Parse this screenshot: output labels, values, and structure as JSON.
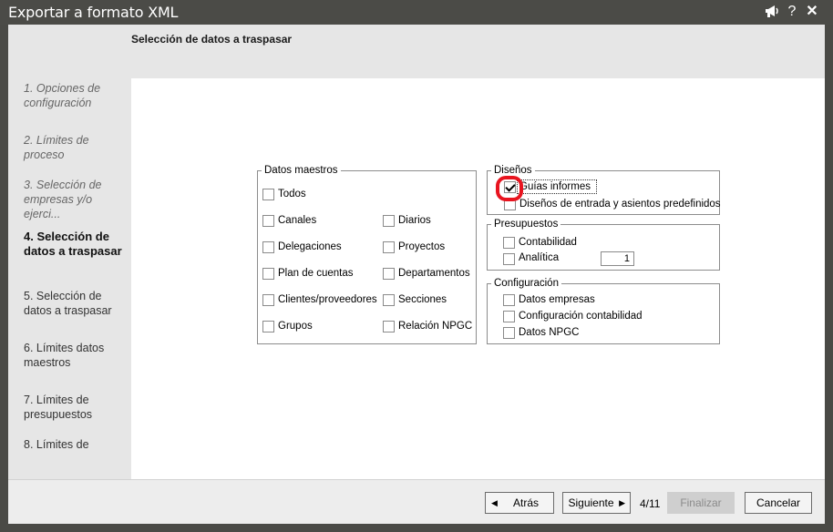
{
  "window": {
    "title": "Exportar a formato XML",
    "icons": [
      "megaphone-icon",
      "help-icon",
      "close-icon"
    ],
    "help_glyph": "?",
    "close_glyph": "✕"
  },
  "header": {
    "title": "Selección de datos a traspasar"
  },
  "sidebar": {
    "steps": [
      {
        "label": "1. Opciones de configuración",
        "state": "done"
      },
      {
        "label": "2. Límites de proceso",
        "state": "done"
      },
      {
        "label": "3. Selección de empresas y/o ejerci...",
        "state": "done"
      },
      {
        "label": "4. Selección de datos a traspasar",
        "state": "current"
      },
      {
        "label": "5. Selección de datos a traspasar",
        "state": "pending"
      },
      {
        "label": "6. Límites datos maestros",
        "state": "pending"
      },
      {
        "label": "7. Límites de presupuestos",
        "state": "pending"
      },
      {
        "label": "8. Límites de",
        "state": "pending"
      }
    ]
  },
  "datos_maestros": {
    "title": "Datos maestros",
    "left": [
      {
        "label": "Todos",
        "checked": false
      },
      {
        "label": "Canales",
        "checked": false
      },
      {
        "label": "Delegaciones",
        "checked": false
      },
      {
        "label": "Plan de cuentas",
        "checked": false
      },
      {
        "label": "Clientes/proveedores",
        "checked": false
      },
      {
        "label": "Grupos",
        "checked": false
      }
    ],
    "right": [
      {
        "label": "Diarios",
        "checked": false
      },
      {
        "label": "Proyectos",
        "checked": false
      },
      {
        "label": "Departamentos",
        "checked": false
      },
      {
        "label": "Secciones",
        "checked": false
      },
      {
        "label": "Relación NPGC",
        "checked": false
      }
    ]
  },
  "disenos": {
    "title": "Diseños",
    "items": [
      {
        "label": "Guías informes",
        "checked": true
      },
      {
        "label": "Diseños de entrada y asientos predefinidos",
        "checked": false
      }
    ]
  },
  "presupuestos": {
    "title": "Presupuestos",
    "items": [
      {
        "label": "Contabilidad",
        "checked": false
      },
      {
        "label": "Analítica",
        "checked": false
      }
    ],
    "analitica_value": "1"
  },
  "configuracion": {
    "title": "Configuración",
    "items": [
      {
        "label": "Datos empresas",
        "checked": false
      },
      {
        "label": "Configuración contabilidad",
        "checked": false
      },
      {
        "label": "Datos NPGC",
        "checked": false
      }
    ]
  },
  "footer": {
    "back_label": "Atrás",
    "back_arrow": "◀",
    "next_label": "Siguiente",
    "next_arrow": "▶",
    "pager": "4/11",
    "finish_label": "Finalizar",
    "cancel_label": "Cancelar"
  }
}
